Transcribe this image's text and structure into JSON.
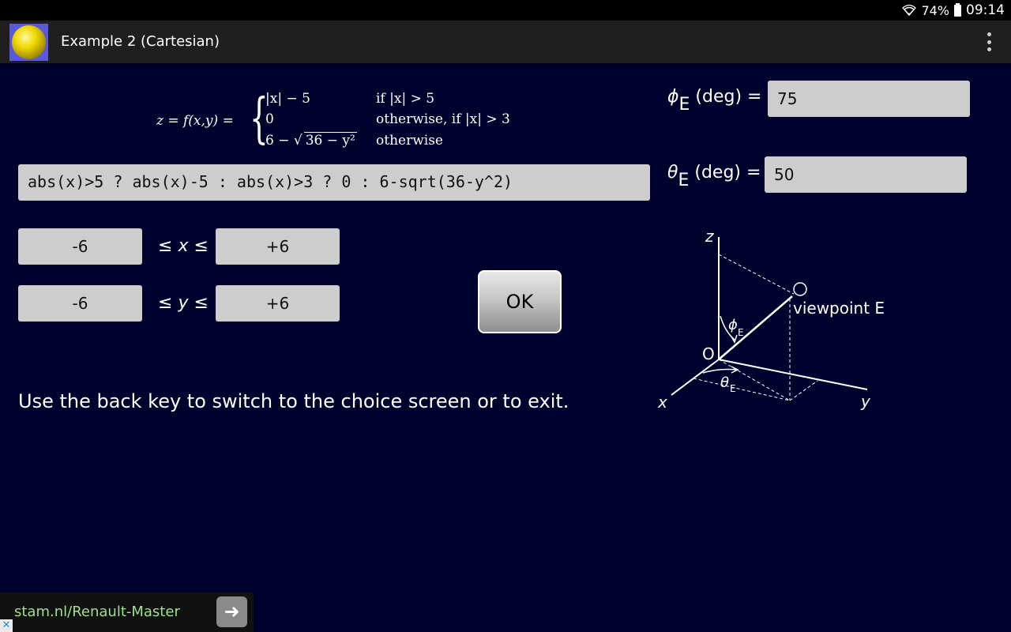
{
  "status": {
    "battery": "74%",
    "time": "09:14"
  },
  "appbar": {
    "title": "Example 2 (Cartesian)"
  },
  "formula": {
    "lhs": "z = f(x,y) =",
    "cases": [
      {
        "expr": "|x| − 5",
        "cond": "if |x| > 5"
      },
      {
        "expr": "0",
        "cond": "otherwise, if |x| > 3"
      },
      {
        "expr_prefix": "6 − ",
        "expr_root": "36 − y²",
        "cond": "otherwise"
      }
    ]
  },
  "expression": {
    "value": "abs(x)>5 ? abs(x)-5 : abs(x)>3 ? 0 : 6-sqrt(36-y^2)"
  },
  "x_range": {
    "min": "-6",
    "max": "+6",
    "label_pre": "≤ ",
    "var": "x",
    "label_post": " ≤"
  },
  "y_range": {
    "min": "-6",
    "max": "+6",
    "label_pre": "≤ ",
    "var": "y",
    "label_post": " ≤"
  },
  "phi": {
    "symbol": "ϕ",
    "sub": "E",
    "unit": "(deg) =",
    "value": "75"
  },
  "theta": {
    "symbol": "θ",
    "sub": "E",
    "unit": "(deg) =",
    "value": "50"
  },
  "ok_label": "OK",
  "instructions": "Use the back key to switch to the choice screen or to exit.",
  "diagram": {
    "axis_z": "z",
    "axis_x": "x",
    "axis_y": "y",
    "origin": "O",
    "viewpoint": "viewpoint E",
    "phi_symbol": "ϕ",
    "theta_symbol": "θ",
    "sub": "E"
  },
  "ad": {
    "text": "stam.nl/Renault-Master",
    "arrow_icon": "arrow-right-icon",
    "close_icon": "close-icon"
  }
}
